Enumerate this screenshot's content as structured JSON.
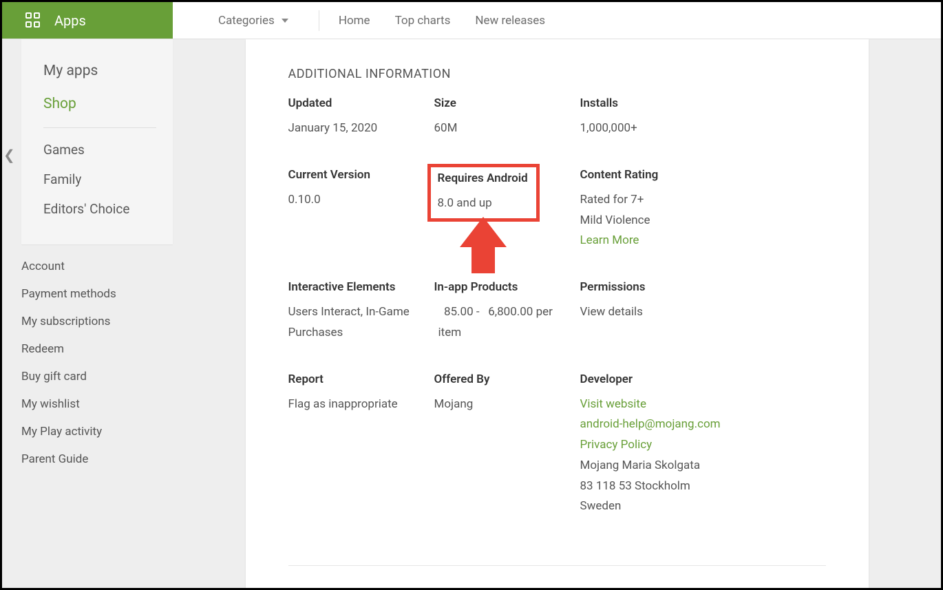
{
  "header": {
    "apps_label": "Apps",
    "categories_label": "Categories",
    "nav": {
      "home": "Home",
      "top_charts": "Top charts",
      "new_releases": "New releases"
    }
  },
  "sidebar": {
    "primary": {
      "my_apps": "My apps",
      "shop": "Shop"
    },
    "secondary": {
      "games": "Games",
      "family": "Family",
      "editors_choice": "Editors' Choice"
    },
    "account": {
      "account": "Account",
      "payment_methods": "Payment methods",
      "my_subscriptions": "My subscriptions",
      "redeem": "Redeem",
      "buy_gift_card": "Buy gift card",
      "my_wishlist": "My wishlist",
      "my_play_activity": "My Play activity",
      "parent_guide": "Parent Guide"
    }
  },
  "section_title": "ADDITIONAL INFORMATION",
  "info": {
    "updated": {
      "label": "Updated",
      "value": "January 15, 2020"
    },
    "size": {
      "label": "Size",
      "value": "60M"
    },
    "installs": {
      "label": "Installs",
      "value": "1,000,000+"
    },
    "current_version": {
      "label": "Current Version",
      "value": "0.10.0"
    },
    "requires_android": {
      "label": "Requires Android",
      "value": "8.0 and up"
    },
    "content_rating": {
      "label": "Content Rating",
      "line1": "Rated for 7+",
      "line2": "Mild Violence",
      "learn_more": "Learn More"
    },
    "interactive_elements": {
      "label": "Interactive Elements",
      "value": "Users Interact, In-Game Purchases"
    },
    "in_app_products": {
      "label": "In-app Products",
      "value": "  85.00 -   6,800.00 per item"
    },
    "permissions": {
      "label": "Permissions",
      "view_details": "View details"
    },
    "report": {
      "label": "Report",
      "flag": "Flag as inappropriate"
    },
    "offered_by": {
      "label": "Offered By",
      "value": "Mojang"
    },
    "developer": {
      "label": "Developer",
      "visit_website": "Visit website",
      "email": "android-help@mojang.com",
      "privacy_policy": "Privacy Policy",
      "addr1": "Mojang Maria Skolgata",
      "addr2": "83 118 53 Stockholm",
      "addr3": "Sweden"
    }
  }
}
